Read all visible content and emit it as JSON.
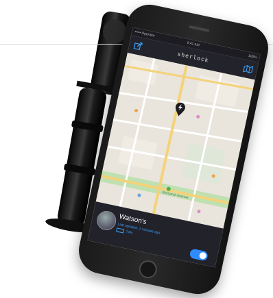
{
  "phone": {
    "status": {
      "carrier": "••••• Operator",
      "time": "9:41 AM",
      "battery": "100%"
    },
    "app_title": "sherlock",
    "icons": {
      "left": "share-icon",
      "right": "map-layers-icon",
      "pin": "bolt-pin-icon"
    },
    "map_labels": {
      "avenue": "Bismarck Avenue"
    },
    "card": {
      "place": "Watson's",
      "last_updated": "Last updated: 2 minutes ago",
      "battery": "74%"
    },
    "toggle_on": true
  },
  "colors": {
    "accent": "#2e8bff",
    "header": "#23232b",
    "map_bg": "#e9e5dc",
    "park": "#bfe0b0",
    "road_major": "#f4d27a"
  }
}
